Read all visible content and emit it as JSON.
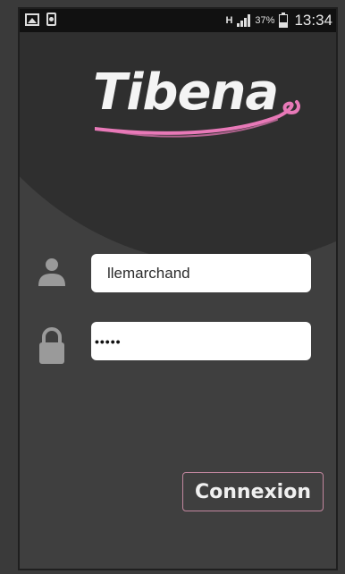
{
  "status_bar": {
    "left_icons": [
      "image-icon",
      "download-icon"
    ],
    "network_label": "H",
    "battery_percent": "37%",
    "battery_level": 0.37,
    "time": "13:34"
  },
  "header": {
    "app_name": "Tibena",
    "accent_color": "#e879b8"
  },
  "form": {
    "username_value": "llemarchand",
    "password_value": "•••••",
    "username_icon": "user-icon",
    "password_icon": "lock-icon"
  },
  "actions": {
    "login_label": "Connexion"
  }
}
